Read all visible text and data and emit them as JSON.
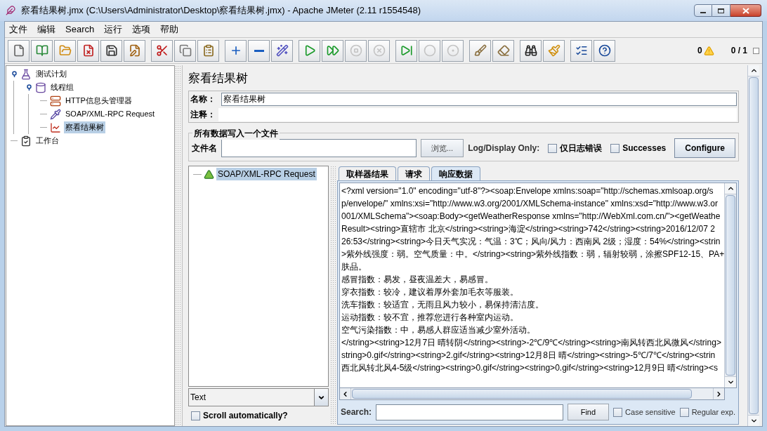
{
  "window": {
    "title": "察看结果树.jmx (C:\\Users\\Administrator\\Desktop\\察看结果树.jmx) - Apache JMeter (2.11 r1554548)"
  },
  "menu": [
    "文件",
    "编辑",
    "Search",
    "运行",
    "选项",
    "帮助"
  ],
  "toolbar": [
    [
      {
        "disabled": false
      },
      {
        "disabled": false
      },
      {
        "disabled": false
      },
      {
        "disabled": false
      },
      {
        "disabled": false
      },
      {
        "disabled": false
      }
    ],
    [
      {
        "disabled": false
      },
      {
        "disabled": false
      },
      {
        "disabled": false
      }
    ],
    [
      {
        "disabled": false
      },
      {
        "disabled": false
      },
      {
        "disabled": false
      }
    ],
    [
      {
        "disabled": false
      },
      {
        "disabled": false
      },
      {
        "disabled": true
      },
      {
        "disabled": true
      }
    ],
    [
      {
        "disabled": false
      },
      {
        "disabled": true
      },
      {
        "disabled": true
      }
    ],
    [
      {
        "disabled": false
      },
      {
        "disabled": false
      }
    ],
    [
      {
        "disabled": false
      },
      {
        "disabled": false
      }
    ],
    [
      {
        "disabled": false
      },
      {
        "disabled": false
      }
    ]
  ],
  "status": {
    "errors": "0",
    "threads": "0 / 1"
  },
  "test_tree": [
    {
      "label": "测试计划",
      "kind": "plan",
      "selected": false,
      "expanded": true,
      "children": [
        {
          "label": "线程组",
          "kind": "thread_group",
          "selected": false,
          "expanded": true,
          "children": [
            {
              "label": "HTTP信息头管理器",
              "kind": "header_manager",
              "selected": false
            },
            {
              "label": "SOAP/XML-RPC Request",
              "kind": "sampler",
              "selected": false
            },
            {
              "label": "察看结果树",
              "kind": "listener",
              "selected": true
            }
          ]
        }
      ]
    },
    {
      "label": "工作台",
      "kind": "workbench",
      "selected": false
    }
  ],
  "element": {
    "title": "察看结果树",
    "name_label": "名称：",
    "name_value": "察看结果树",
    "comment_label": "注释："
  },
  "file_group": {
    "title": "所有数据写入一个文件",
    "file_label": "文件名",
    "browse": "浏览...",
    "log_label": "Log/Display Only:",
    "checkboxes": [
      {
        "label": "仅日志错误",
        "checked": false
      },
      {
        "label": "Successes",
        "checked": false
      }
    ],
    "configure": "Configure"
  },
  "results_tree": {
    "items": [
      {
        "label": "SOAP/XML-RPC Request",
        "selected": true
      }
    ],
    "renderer": "Text",
    "scroll": {
      "label": "Scroll automatically?",
      "checked": false
    }
  },
  "tabs": [
    {
      "label": "取样器结果",
      "selected": false
    },
    {
      "label": "请求",
      "selected": false
    },
    {
      "label": "响应数据",
      "selected": true
    }
  ],
  "response_lines": [
    "<?xml version=\"1.0\" encoding=\"utf-8\"?><soap:Envelope xmlns:soap=\"http://schemas.xmlsoap.org/s",
    "p/envelope/\" xmlns:xsi=\"http://www.w3.org/2001/XMLSchema-instance\" xmlns:xsd=\"http://www.w3.or",
    "001/XMLSchema\"><soap:Body><getWeatherResponse xmlns=\"http://WebXml.com.cn/\"><getWeathe",
    "Result><string>直辖市 北京</string><string>海淀</string><string>742</string><string>2016/12/07 2",
    "26:53</string><string>今日天气实况：气温：3℃；风向/风力：西南风 2级；湿度：54%</string><strin",
    ">紫外线强度：弱。空气质量：中。</string><string>紫外线指数：弱，辐射较弱，涂擦SPF12-15、PA+",
    "肤品。",
    "感冒指数：易发，昼夜温差大，易感冒。",
    "穿衣指数：较冷，建议着厚外套加毛衣等服装。",
    "洗车指数：较适宜，无雨且风力较小，易保持清洁度。",
    "运动指数：较不宜，推荐您进行各种室内运动。",
    "空气污染指数：中，易感人群应适当减少室外活动。",
    "</string><string>12月7日 晴转阴</string><string>-2℃/9℃</string><string>南风转西北风微风</string>",
    "string>0.gif</string><string>2.gif</string><string>12月8日 晴</string><string>-5℃/7℃</string><strin",
    "西北风转北风4-5级</string><string>0.gif</string><string>0.gif</string><string>12月9日 晴</string><s"
  ],
  "search": {
    "label": "Search:",
    "find": "Find",
    "options": [
      {
        "label": "Case sensitive",
        "checked": false
      },
      {
        "label": "Regular exp.",
        "checked": false
      }
    ]
  }
}
